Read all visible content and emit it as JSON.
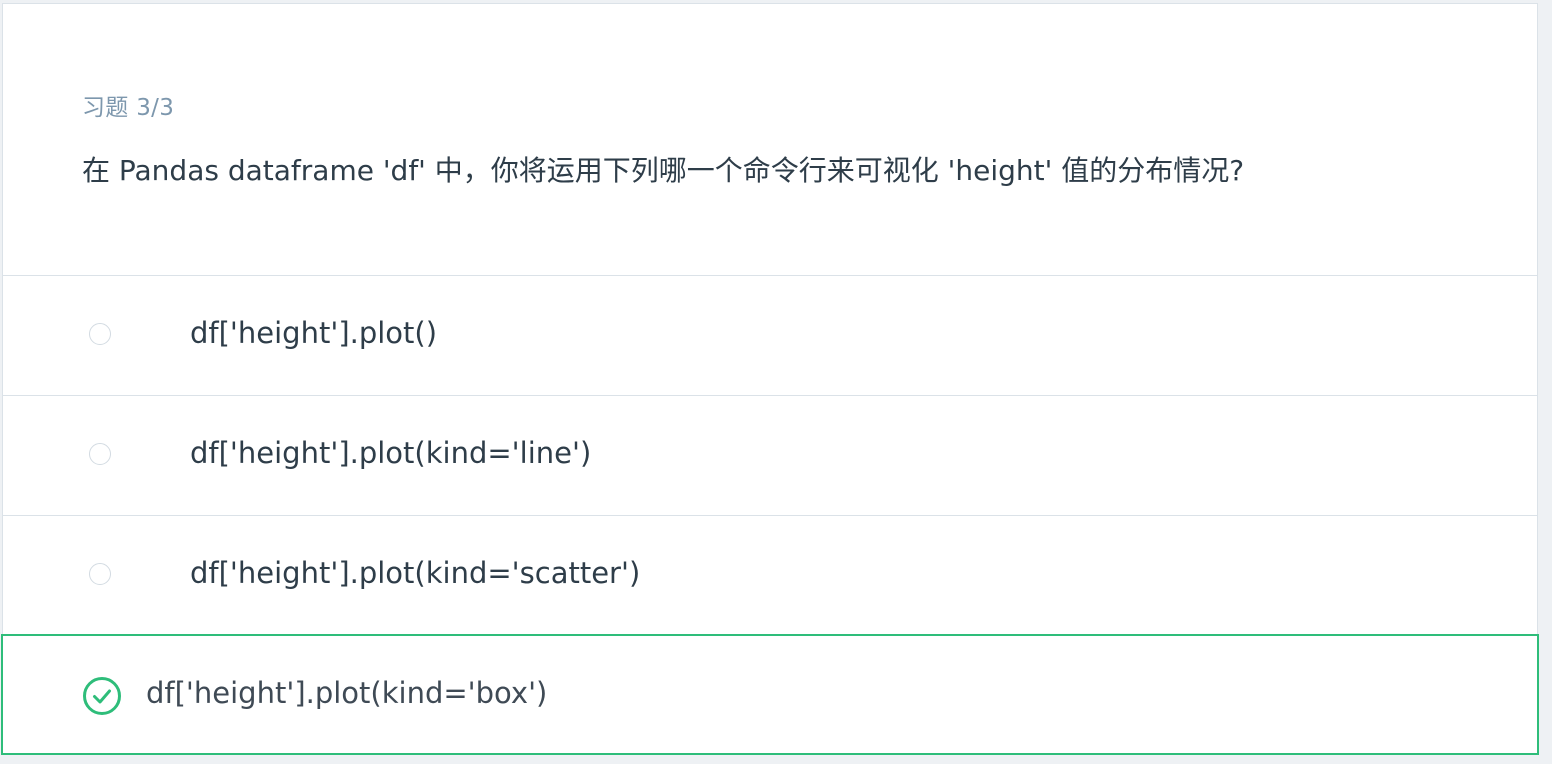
{
  "quiz": {
    "progress": "习题 3/3",
    "question": "在 Pandas dataframe 'df' 中，你将运用下列哪一个命令行来可视化 'height' 值的分布情况?",
    "options": [
      {
        "label": "df['height'].plot()",
        "selected": false
      },
      {
        "label": "df['height'].plot(kind='line')",
        "selected": false
      },
      {
        "label": "df['height'].plot(kind='scatter')",
        "selected": false
      },
      {
        "label": "df['height'].plot(kind='box')",
        "selected": true
      }
    ]
  },
  "colors": {
    "correct": "#2ebd7a",
    "border": "#dbe2e8",
    "muted_text": "#7d97ad",
    "text": "#2e3d49"
  },
  "icons": {
    "radio": "radio-circle-icon",
    "selected": "check-circle-icon"
  }
}
